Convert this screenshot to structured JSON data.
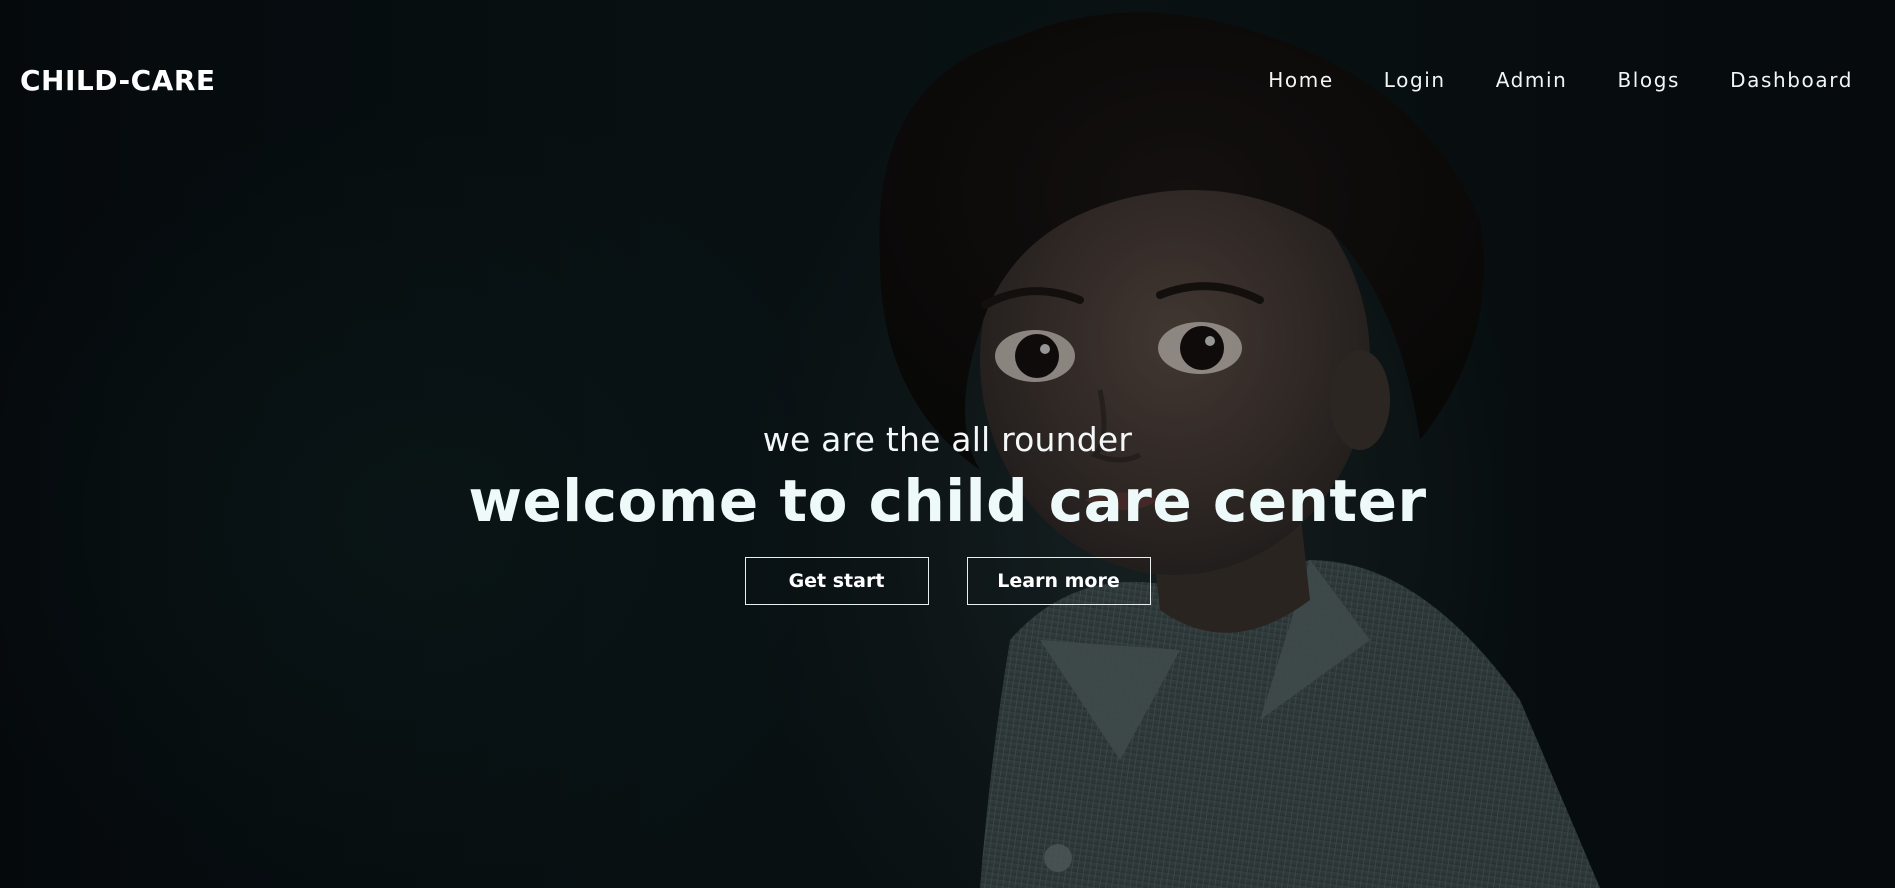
{
  "brand": "CHILD-CARE",
  "nav": {
    "items": [
      {
        "label": "Home"
      },
      {
        "label": "Login"
      },
      {
        "label": "Admin"
      },
      {
        "label": "Blogs"
      },
      {
        "label": "Dashboard"
      }
    ]
  },
  "hero": {
    "subtitle": "we are the all rounder",
    "title": "welcome to child care center",
    "primary_button": "Get start",
    "secondary_button": "Learn more",
    "background_image": "child-portrait-photo"
  },
  "colors": {
    "background": "#05090c",
    "text": "#ffffff",
    "title_tint": "#eefaf9"
  }
}
